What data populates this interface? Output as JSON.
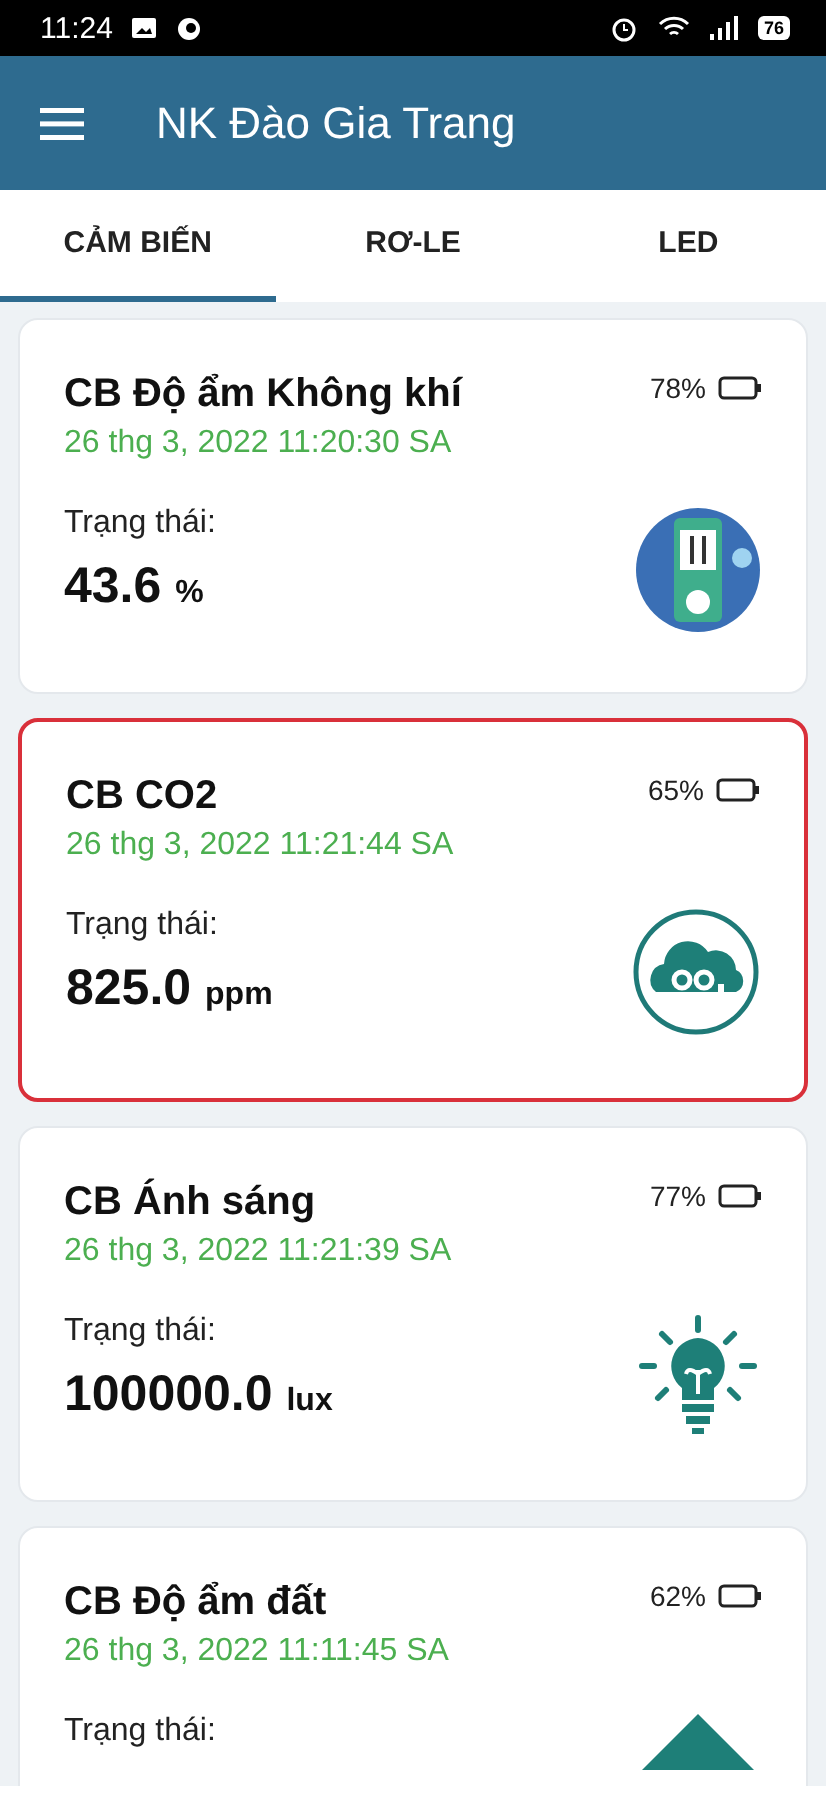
{
  "status_bar": {
    "time": "11:24",
    "battery": "76"
  },
  "app_bar": {
    "title": "NK Đào Gia Trang"
  },
  "tabs": [
    {
      "label": "CẢM BIẾN",
      "selected": true
    },
    {
      "label": "RƠ-LE",
      "selected": false
    },
    {
      "label": "LED",
      "selected": false
    }
  ],
  "sensors": [
    {
      "name": "CB Độ ẩm Không khí",
      "time": "26 thg 3, 2022 11:20:30 SA",
      "battery": "78%",
      "status_label": "Trạng thái:",
      "value": "43.6",
      "unit": "%",
      "kind": "humidity",
      "selected": false
    },
    {
      "name": "CB CO2",
      "time": "26 thg 3, 2022 11:21:44 SA",
      "battery": "65%",
      "status_label": "Trạng thái:",
      "value": "825.0",
      "unit": "ppm",
      "kind": "co2",
      "selected": true
    },
    {
      "name": "CB Ánh sáng",
      "time": "26 thg 3, 2022 11:21:39 SA",
      "battery": "77%",
      "status_label": "Trạng thái:",
      "value": "100000.0",
      "unit": "lux",
      "kind": "light",
      "selected": false
    },
    {
      "name": "CB Độ ẩm đất",
      "time": "26 thg 3, 2022 11:11:45 SA",
      "battery": "62%",
      "status_label": "Trạng thái:",
      "kind": "soil",
      "selected": false
    }
  ]
}
